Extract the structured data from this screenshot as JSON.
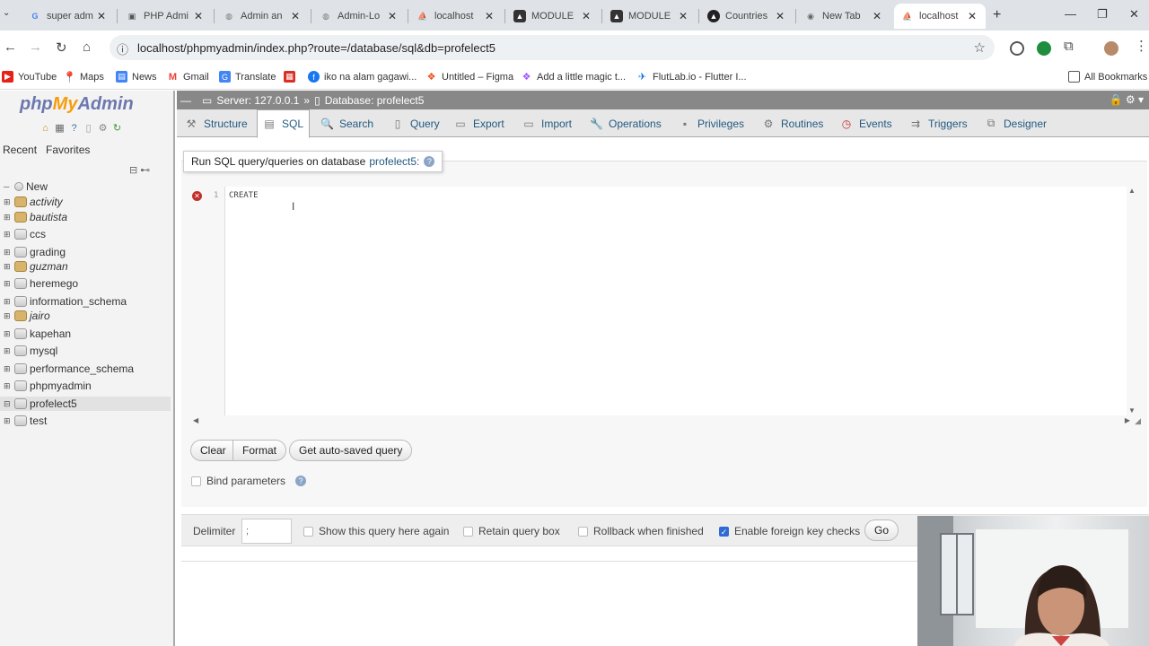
{
  "browser": {
    "tabs": [
      {
        "title": "super adm",
        "active": false
      },
      {
        "title": "PHP Admi",
        "active": false
      },
      {
        "title": "Admin an",
        "active": false
      },
      {
        "title": "Admin-Lo",
        "active": false
      },
      {
        "title": "localhost",
        "active": false
      },
      {
        "title": "MODULE",
        "active": false
      },
      {
        "title": "MODULE",
        "active": false
      },
      {
        "title": "Countries",
        "active": false
      },
      {
        "title": "New Tab",
        "active": false
      },
      {
        "title": "localhost",
        "active": true
      }
    ],
    "url": "localhost/phpmyadmin/index.php?route=/database/sql&db=profelect5",
    "bookmarks": [
      {
        "label": "YouTube",
        "icon": "youtube-icon",
        "color": "#e62117"
      },
      {
        "label": "Maps",
        "icon": "maps-icon",
        "color": "#34a853"
      },
      {
        "label": "News",
        "icon": "news-icon",
        "color": "#4285f4"
      },
      {
        "label": "Gmail",
        "icon": "gmail-icon",
        "color": "#ea4335"
      },
      {
        "label": "Translate",
        "icon": "translate-icon",
        "color": "#4285f4"
      },
      {
        "label": "",
        "icon": "bookmark-app-icon",
        "color": "#d93025"
      },
      {
        "label": "iko na alam gagawi...",
        "icon": "facebook-icon",
        "color": "#1877f2"
      },
      {
        "label": "Untitled – Figma",
        "icon": "figma-icon",
        "color": "#f24e1e"
      },
      {
        "label": "Add a little magic t...",
        "icon": "figma-icon",
        "color": "#a259ff"
      },
      {
        "label": "FlutLab.io - Flutter I...",
        "icon": "flutlab-icon",
        "color": "#1a73e8"
      }
    ],
    "all_bookmarks": "All Bookmarks"
  },
  "sidebar": {
    "logo_php": "php",
    "logo_my": "My",
    "logo_admin": "Admin",
    "tabs": [
      "Recent",
      "Favorites"
    ],
    "databases": [
      {
        "name": "New",
        "style": "new"
      },
      {
        "name": "activity",
        "style": "folder"
      },
      {
        "name": "bautista",
        "style": "folder"
      },
      {
        "name": "ccs",
        "style": "db"
      },
      {
        "name": "grading",
        "style": "db"
      },
      {
        "name": "guzman",
        "style": "folder"
      },
      {
        "name": "heremego",
        "style": "db"
      },
      {
        "name": "information_schema",
        "style": "db"
      },
      {
        "name": "jairo",
        "style": "folder"
      },
      {
        "name": "kapehan",
        "style": "db"
      },
      {
        "name": "mysql",
        "style": "db"
      },
      {
        "name": "performance_schema",
        "style": "db"
      },
      {
        "name": "phpmyadmin",
        "style": "db"
      },
      {
        "name": "profelect5",
        "style": "selected"
      },
      {
        "name": "test",
        "style": "db"
      }
    ]
  },
  "main": {
    "breadcrumb": {
      "server": "Server: 127.0.0.1",
      "separator": "»",
      "database": "Database: profelect5"
    },
    "tabs": [
      {
        "label": "Structure",
        "icon": "structure-icon",
        "active": false
      },
      {
        "label": "SQL",
        "icon": "sql-icon",
        "active": true
      },
      {
        "label": "Search",
        "icon": "search-icon",
        "active": false
      },
      {
        "label": "Query",
        "icon": "query-icon",
        "active": false
      },
      {
        "label": "Export",
        "icon": "export-icon",
        "active": false
      },
      {
        "label": "Import",
        "icon": "import-icon",
        "active": false
      },
      {
        "label": "Operations",
        "icon": "operations-icon",
        "active": false
      },
      {
        "label": "Privileges",
        "icon": "privileges-icon",
        "active": false
      },
      {
        "label": "Routines",
        "icon": "routines-icon",
        "active": false
      },
      {
        "label": "Events",
        "icon": "events-icon",
        "active": false
      },
      {
        "label": "Triggers",
        "icon": "triggers-icon",
        "active": false
      },
      {
        "label": "Designer",
        "icon": "designer-icon",
        "active": false
      }
    ],
    "query_legend": "Run SQL query/queries on database",
    "query_db": "profelect5:",
    "editor": {
      "line_number": "1",
      "code": "CREATE"
    },
    "buttons": {
      "clear": "Clear",
      "format": "Format",
      "autosaved": "Get auto-saved query"
    },
    "bind_parameters": "Bind parameters",
    "delimiter_label": "Delimiter",
    "delimiter_value": ";",
    "options": {
      "show_query": "Show this query here again",
      "retain_box": "Retain query box",
      "rollback": "Rollback when finished",
      "foreign_keys": "Enable foreign key checks"
    },
    "go": "Go"
  }
}
